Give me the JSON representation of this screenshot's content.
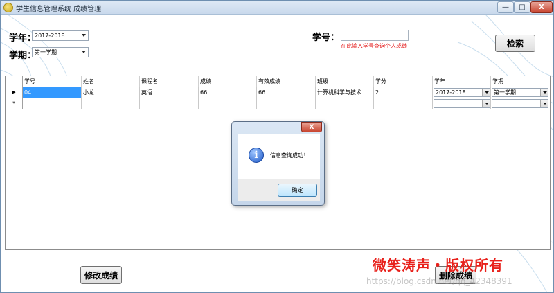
{
  "window": {
    "title": "学生信息管理系统 成绩管理",
    "minimize_glyph": "—",
    "maximize_glyph": "□",
    "close_glyph": "X"
  },
  "filters": {
    "year_label": "学年：",
    "year_value": "2017-2018",
    "term_label": "学期：",
    "term_value": "第一学期",
    "student_id_label": "学号：",
    "student_id_value": "",
    "student_id_hint": "在此输入学号查询个人成绩",
    "search_button": "检索"
  },
  "grid": {
    "columns": [
      "学号",
      "姓名",
      "课程名",
      "成绩",
      "有效成绩",
      "班级",
      "学分",
      "学年",
      "学期"
    ],
    "rows": [
      {
        "indicator": "▶",
        "cells": [
          "04",
          "小龙",
          "英语",
          "66",
          "66",
          "计算机科学与技术",
          "2",
          "2017-2018",
          "第一学期"
        ]
      }
    ],
    "new_row_indicator": "*"
  },
  "dialog": {
    "close_glyph": "X",
    "icon_glyph": "i",
    "message": "信息查询成功！",
    "ok_button": "确定"
  },
  "actions": {
    "modify_button": "修改成绩",
    "delete_button": "删除成绩"
  },
  "watermark": {
    "text": "微笑涛声・版权所有",
    "url": "https://blog.csdn.net/qq_42348391"
  },
  "colors": {
    "selection": "#3399ff",
    "hint_red": "#e31010",
    "watermark_red": "#e8211b"
  }
}
